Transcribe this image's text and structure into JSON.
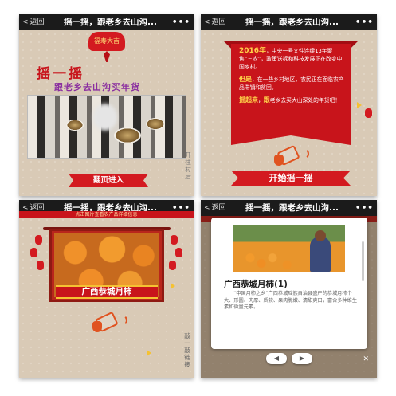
{
  "common": {
    "back_label": "返回",
    "bar_title": "摇一摇，跟老乡去山沟...",
    "more": "•••"
  },
  "panel1": {
    "medallion": "福寿大吉",
    "title": "摇一摇",
    "subtitle": "跟老乡去山沟买年货",
    "enter_button": "翻页进入",
    "side_text": "开往村后"
  },
  "panel2": {
    "year": "2016年",
    "para1": "，中央一号文件连续13年聚焦“三农”，政策送拆和科技发展正在改变中国乡村。",
    "hl2": "但是",
    "para2": "，在一些乡村地区，农民正在面临农产品滞销和贫困。",
    "hl3": "摇起来",
    "sep3": "，",
    "hl3b": "跟",
    "para3": "老乡去买大山深处的年货吧！",
    "shake_button": "开始摇一摇"
  },
  "panel3": {
    "banner": "点击图片查看农产品详细信息",
    "label": "广西恭城月柿",
    "side_text": "敲一敲链接"
  },
  "panel4": {
    "title": "广西恭城月柿(1)",
    "description": "“中国月柿之乡”广西恭城瑶族自治县盛产的恭城月柿个大、形圆、肉厚、质软、果肉脆嫩、清甜爽口，富含多种维生素和微量元素。",
    "prev": "◀",
    "next": "▶",
    "close": "✕"
  },
  "colors": {
    "accent_red": "#c8141b",
    "background": "#d9cab6",
    "gold": "#f5c232"
  }
}
